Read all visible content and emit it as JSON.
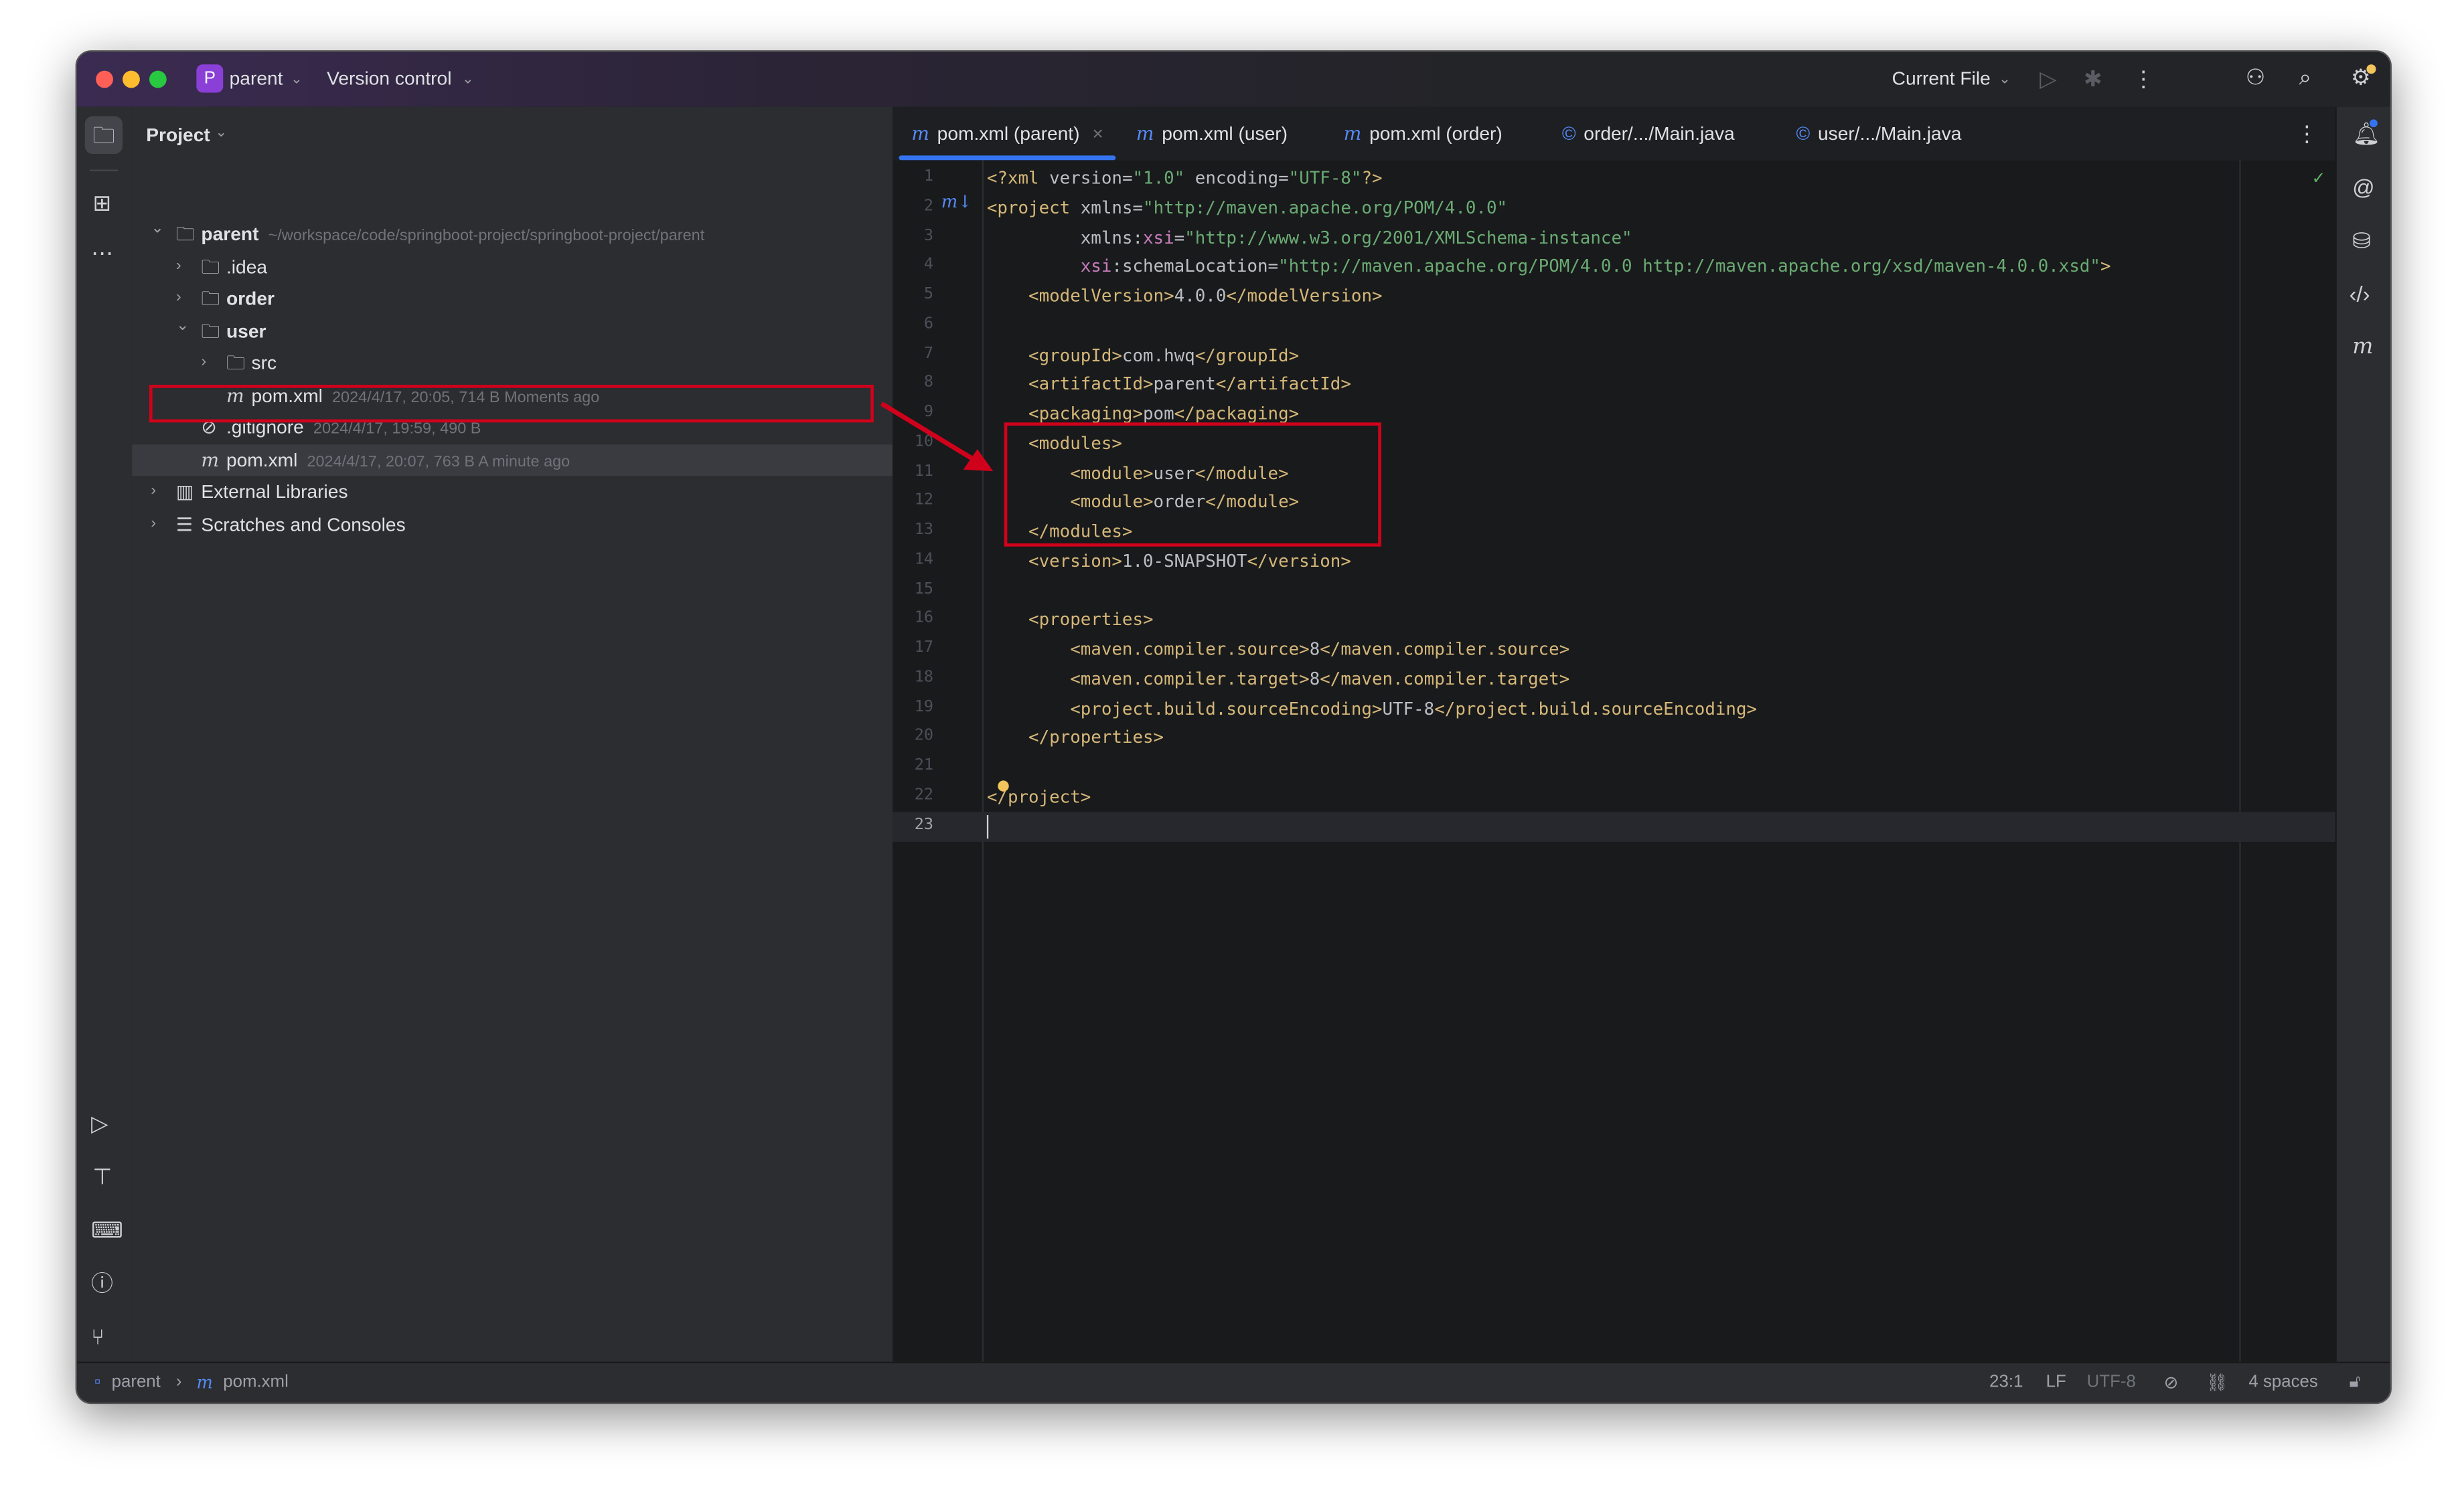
{
  "titlebar": {
    "project_initial": "P",
    "project_name": "parent",
    "vcs": "Version control",
    "run_config": "Current File"
  },
  "project_panel": {
    "title": "Project",
    "tree": [
      {
        "label": "parent",
        "meta": "~/workspace/code/springboot-project/springboot-project/parent",
        "depth": 0,
        "expanded": true,
        "icon": "module-folder-icon",
        "bold": true
      },
      {
        "label": ".idea",
        "meta": "",
        "depth": 1,
        "expanded": false,
        "icon": "folder-icon"
      },
      {
        "label": "order",
        "meta": "",
        "depth": 1,
        "expanded": false,
        "icon": "module-folder-icon",
        "bold": true
      },
      {
        "label": "user",
        "meta": "",
        "depth": 1,
        "expanded": true,
        "icon": "module-folder-icon",
        "bold": true
      },
      {
        "label": "src",
        "meta": "",
        "depth": 2,
        "expanded": false,
        "icon": "folder-icon"
      },
      {
        "label": "pom.xml",
        "meta": "2024/4/17, 20:05, 714 B Moments ago",
        "depth": 2,
        "leaf": true,
        "icon": "maven-icon"
      },
      {
        "label": ".gitignore",
        "meta": "2024/4/17, 19:59, 490 B",
        "depth": 1,
        "leaf": true,
        "icon": "ignore-file-icon"
      },
      {
        "label": "pom.xml",
        "meta": "2024/4/17, 20:07, 763 B A minute ago",
        "depth": 1,
        "leaf": true,
        "icon": "maven-icon",
        "selected": true
      },
      {
        "label": "External Libraries",
        "meta": "",
        "depth": 0,
        "expanded": false,
        "icon": "library-icon"
      },
      {
        "label": "Scratches and Consoles",
        "meta": "",
        "depth": 0,
        "expanded": false,
        "icon": "scratches-icon"
      }
    ]
  },
  "tabs": [
    {
      "label": "pom.xml (parent)",
      "icon": "maven-icon",
      "active": true,
      "closable": true
    },
    {
      "label": "pom.xml (user)",
      "icon": "maven-icon"
    },
    {
      "label": "pom.xml (order)",
      "icon": "maven-icon"
    },
    {
      "label": "order/.../Main.java",
      "icon": "java-class-icon"
    },
    {
      "label": "user/.../Main.java",
      "icon": "java-class-icon"
    }
  ],
  "code_lines": [
    [
      [
        "<?xml ",
        "tag"
      ],
      [
        "version=",
        "attr"
      ],
      [
        "\"1.0\"",
        "val"
      ],
      [
        " encoding=",
        "attr"
      ],
      [
        "\"UTF-8\"",
        "val"
      ],
      [
        "?>",
        "tag"
      ]
    ],
    [
      [
        "<project ",
        "tag"
      ],
      [
        "xmlns=",
        "attr"
      ],
      [
        "\"http://maven.apache.org/POM/4.0.0\"",
        "val"
      ]
    ],
    [
      [
        "         xmlns:",
        "attr"
      ],
      [
        "xsi",
        "ns"
      ],
      [
        "=",
        "attr"
      ],
      [
        "\"http://www.w3.org/2001/XMLSchema-instance\"",
        "val"
      ]
    ],
    [
      [
        "         ",
        "attr"
      ],
      [
        "xsi",
        "ns"
      ],
      [
        ":schemaLocation=",
        "attr"
      ],
      [
        "\"http://maven.apache.org/POM/4.0.0 http://maven.apache.org/xsd/maven-4.0.0.xsd\"",
        "val"
      ],
      [
        ">",
        "tag"
      ]
    ],
    [
      [
        "    <modelVersion>",
        "tag"
      ],
      [
        "4.0.0",
        "txt"
      ],
      [
        "</modelVersion>",
        "tag"
      ]
    ],
    [],
    [
      [
        "    <groupId>",
        "tag"
      ],
      [
        "com.hwq",
        "txt"
      ],
      [
        "</groupId>",
        "tag"
      ]
    ],
    [
      [
        "    <artifactId>",
        "tag"
      ],
      [
        "parent",
        "txt"
      ],
      [
        "</artifactId>",
        "tag"
      ]
    ],
    [
      [
        "    <packaging>",
        "tag"
      ],
      [
        "pom",
        "txt"
      ],
      [
        "</packaging>",
        "tag"
      ]
    ],
    [
      [
        "    <modules>",
        "tag"
      ]
    ],
    [
      [
        "        <module>",
        "tag"
      ],
      [
        "user",
        "txt"
      ],
      [
        "</module>",
        "tag"
      ]
    ],
    [
      [
        "        <module>",
        "tag"
      ],
      [
        "order",
        "txt"
      ],
      [
        "</module>",
        "tag"
      ]
    ],
    [
      [
        "    </modules>",
        "tag"
      ]
    ],
    [
      [
        "    <version>",
        "tag"
      ],
      [
        "1.0-SNAPSHOT",
        "txt"
      ],
      [
        "</version>",
        "tag"
      ]
    ],
    [],
    [
      [
        "    <properties>",
        "tag"
      ]
    ],
    [
      [
        "        <maven.compiler.source>",
        "tag"
      ],
      [
        "8",
        "txt"
      ],
      [
        "</maven.compiler.source>",
        "tag"
      ]
    ],
    [
      [
        "        <maven.compiler.target>",
        "tag"
      ],
      [
        "8",
        "txt"
      ],
      [
        "</maven.compiler.target>",
        "tag"
      ]
    ],
    [
      [
        "        <project.build.sourceEncoding>",
        "tag"
      ],
      [
        "UTF-8",
        "txt"
      ],
      [
        "</project.build.sourceEncoding>",
        "tag"
      ]
    ],
    [
      [
        "    </properties>",
        "tag"
      ]
    ],
    [],
    [
      [
        "</project>",
        "tag"
      ]
    ],
    []
  ],
  "current_line": 23,
  "status": {
    "breadcrumb": [
      "parent",
      "pom.xml"
    ],
    "position": "23:1",
    "line_ending": "LF",
    "encoding": "UTF-8",
    "indent": "4 spaces"
  },
  "colors": {
    "accent": "#3574f0",
    "annotation": "#d0021b",
    "tag": "#d5b778",
    "string": "#6aab73",
    "namespace": "#c77dbb"
  }
}
